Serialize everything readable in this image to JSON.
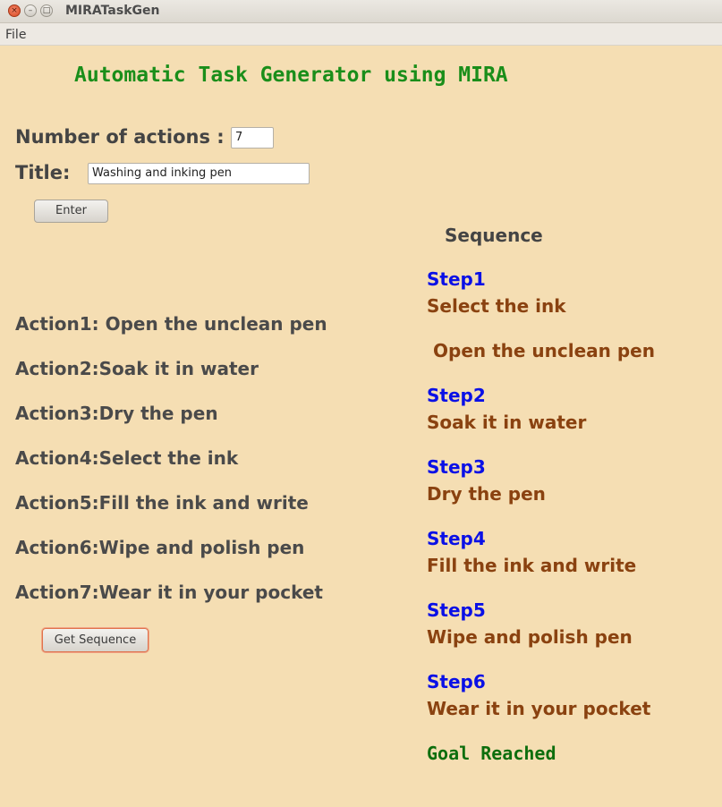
{
  "window": {
    "title": "MIRATaskGen"
  },
  "menu": {
    "file": "File"
  },
  "heading": "Automatic Task Generator using MIRA",
  "form": {
    "num_actions_label": "Number of actions :",
    "num_actions_value": "7",
    "title_label": "Title:",
    "title_value": "Washing and inking pen",
    "enter_button": "Enter"
  },
  "actions": [
    "Action1: Open the unclean pen",
    "Action2:Soak it in water",
    "Action3:Dry the pen",
    "Action4:Select the ink",
    "Action5:Fill the ink and write",
    "Action6:Wipe and polish pen",
    "Action7:Wear it in your pocket"
  ],
  "get_sequence_button": "Get Sequence",
  "sequence": {
    "heading": "Sequence",
    "step1_label": "Step1",
    "step1_text": "Select the ink",
    "extra_text": "Open the unclean pen",
    "steps": [
      {
        "label": "Step2",
        "text": "Soak it in water"
      },
      {
        "label": "Step3",
        "text": "Dry the pen"
      },
      {
        "label": "Step4",
        "text": "Fill the ink and write"
      },
      {
        "label": "Step5",
        "text": "Wipe and polish pen"
      },
      {
        "label": "Step6",
        "text": "Wear it in your pocket"
      }
    ],
    "goal": "Goal Reached"
  }
}
